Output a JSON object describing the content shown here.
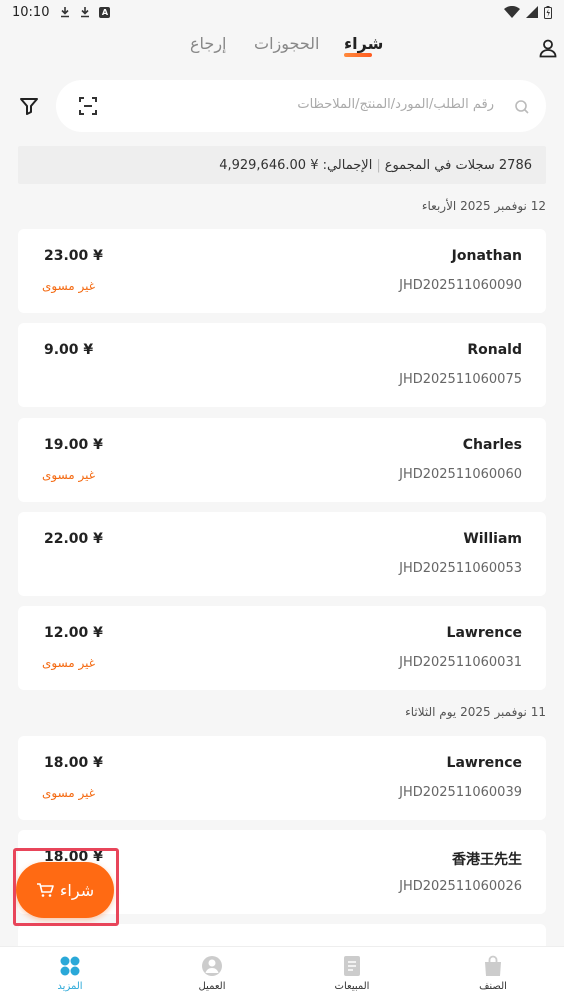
{
  "status_bar": {
    "time": "10:10"
  },
  "tabs": [
    {
      "label": "شراء",
      "active": true
    },
    {
      "label": "الحجوزات",
      "active": false
    },
    {
      "label": "إرجاع",
      "active": false
    }
  ],
  "search": {
    "placeholder": "رقم الطلب/المورد/المنتج/الملاحظات"
  },
  "summary": {
    "count": "2786",
    "records_label": "سجلات في المجموع",
    "total_label": "الإجمالي: ¥",
    "total_value": "4,929,646.00"
  },
  "groups": [
    {
      "date": "12 نوفمبر 2025 الأربعاء",
      "orders": [
        {
          "name": "Jonathan",
          "code": "JHD202511060090",
          "amount": "23.00 ¥",
          "status": "غير مسوى"
        },
        {
          "name": "Ronald",
          "code": "JHD202511060075",
          "amount": "9.00 ¥",
          "status": ""
        },
        {
          "name": "Charles",
          "code": "JHD202511060060",
          "amount": "19.00 ¥",
          "status": "غير مسوى"
        },
        {
          "name": "William",
          "code": "JHD202511060053",
          "amount": "22.00 ¥",
          "status": ""
        },
        {
          "name": "Lawrence",
          "code": "JHD202511060031",
          "amount": "12.00 ¥",
          "status": "غير مسوى"
        }
      ]
    },
    {
      "date": "11 نوفمبر 2025 يوم الثلاثاء",
      "orders": [
        {
          "name": "Lawrence",
          "code": "JHD202511060039",
          "amount": "18.00 ¥",
          "status": "غير مسوى"
        },
        {
          "name": "香港王先生",
          "code": "JHD202511060026",
          "amount": "18.00 ¥",
          "status": ""
        }
      ]
    }
  ],
  "fab": {
    "label": "شراء"
  },
  "bottom_nav": [
    {
      "label": "المزيد",
      "icon": "grid-icon",
      "active": true
    },
    {
      "label": "العميل",
      "icon": "customer-icon",
      "active": false
    },
    {
      "label": "المبيعات",
      "icon": "document-icon",
      "active": false
    },
    {
      "label": "الصنف",
      "icon": "bag-icon",
      "active": false
    }
  ],
  "colors": {
    "accent": "#ff6a13",
    "status": "#f46a12",
    "nav_active": "#2aa8d8"
  }
}
